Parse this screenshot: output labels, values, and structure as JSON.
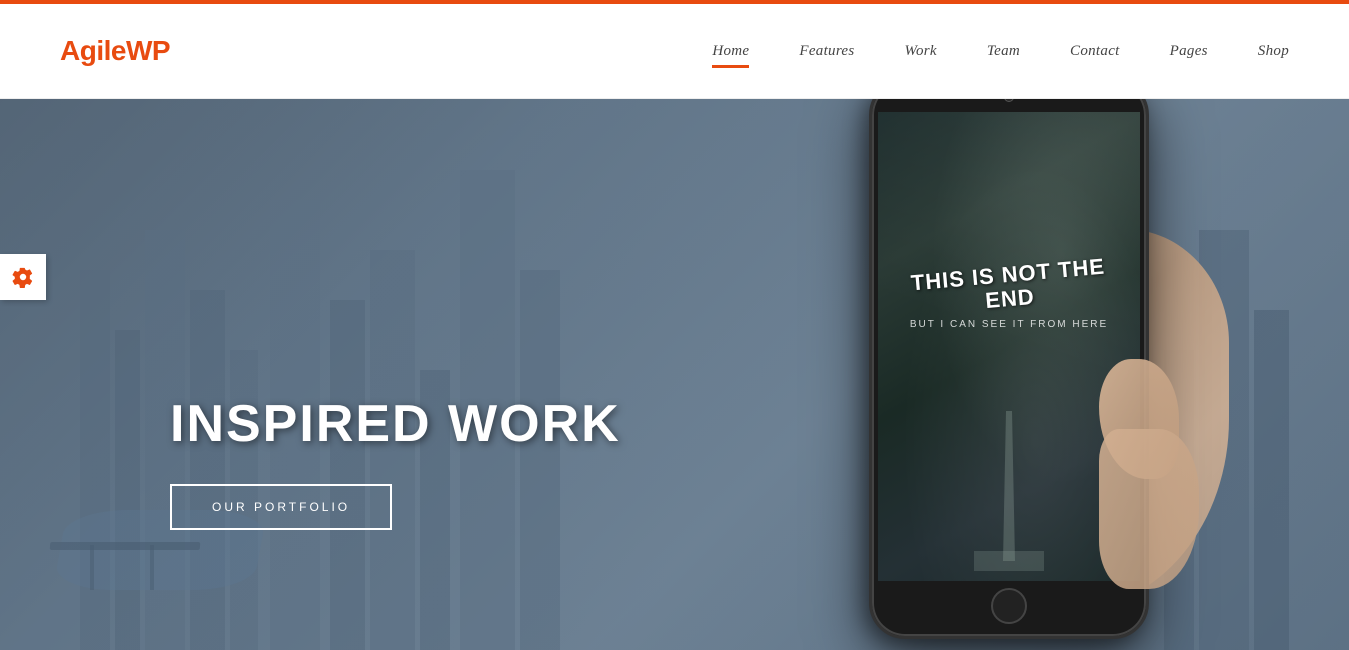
{
  "topBar": {
    "color": "#e84b10"
  },
  "header": {
    "logo": {
      "textBlack": "Agile",
      "textOrange": "WP"
    },
    "nav": {
      "items": [
        {
          "label": "Home",
          "active": true
        },
        {
          "label": "Features",
          "active": false
        },
        {
          "label": "Work",
          "active": false
        },
        {
          "label": "Team",
          "active": false
        },
        {
          "label": "Contact",
          "active": false
        },
        {
          "label": "Pages",
          "active": false
        },
        {
          "label": "Shop",
          "active": false
        }
      ]
    }
  },
  "hero": {
    "title": "INSPIRED WORK",
    "buttonLabel": "OUR PORTFOLIO",
    "phoneText": {
      "line1": "THIS IS NOT THE END",
      "line2": "BUT I CAN SEE IT FROM HERE"
    }
  },
  "settingsIcon": {
    "symbol": "⚙"
  }
}
